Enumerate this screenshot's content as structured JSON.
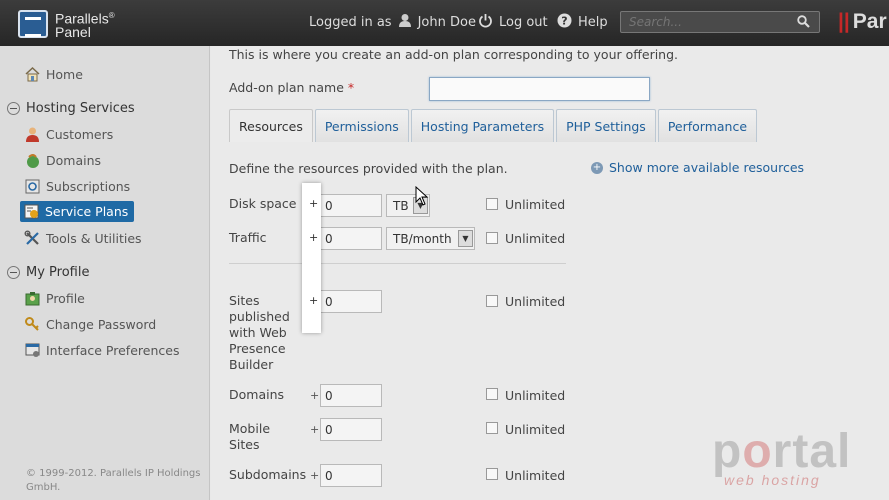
{
  "topbar": {
    "logo_line1": "Parallels",
    "logo_reg": "®",
    "logo_line2": "Panel",
    "logged_in_as": "Logged in as",
    "user_name": "John Doe",
    "logout": "Log out",
    "help": "Help",
    "search_placeholder": "Search...",
    "brand_right": "Par"
  },
  "sidebar": {
    "home": "Home",
    "hosting_services": "Hosting Services",
    "customers": "Customers",
    "domains": "Domains",
    "subscriptions": "Subscriptions",
    "service_plans": "Service Plans",
    "tools_utilities": "Tools & Utilities",
    "my_profile": "My Profile",
    "profile": "Profile",
    "change_password": "Change Password",
    "interface_preferences": "Interface Preferences",
    "copyright": "© 1999-2012. Parallels IP Holdings GmbH."
  },
  "main": {
    "intro": "This is where you create an add-on plan corresponding to your offering.",
    "plan_name_label": "Add-on plan name",
    "required_mark": "*",
    "plan_name_value": "",
    "tabs": [
      "Resources",
      "Permissions",
      "Hosting Parameters",
      "PHP Settings",
      "Performance"
    ],
    "define_text": "Define the resources provided with the plan.",
    "show_more": "Show more available resources",
    "plus": "+",
    "unlimited": "Unlimited",
    "resources": {
      "disk_space": {
        "label": "Disk space",
        "value": "0",
        "unit": "TB"
      },
      "traffic": {
        "label": "Traffic",
        "value": "0",
        "unit": "TB/month"
      },
      "sites_wpb": {
        "label": "Sites published with Web Presence Builder",
        "value": "0"
      },
      "domains": {
        "label": "Domains",
        "value": "0"
      },
      "mobile_sites": {
        "label": "Mobile Sites",
        "value": "0"
      },
      "subdomains": {
        "label": "Subdomains",
        "value": "0"
      }
    }
  },
  "watermark": {
    "line1_a": "p",
    "line1_b": "o",
    "line1_c": "rtal",
    "line2": "web hosting"
  },
  "colors": {
    "accent": "#1f6aa5",
    "link": "#1f5f9a",
    "topbar": "#2e2e2e",
    "required": "#c62828"
  }
}
